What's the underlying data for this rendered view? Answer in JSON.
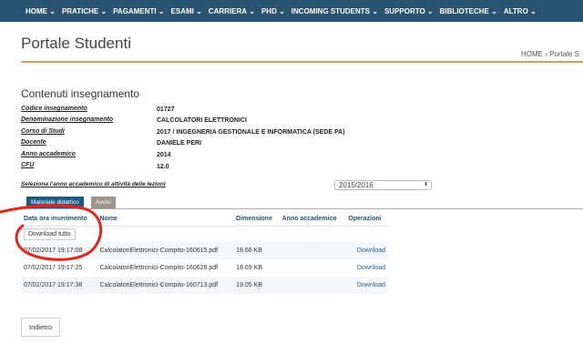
{
  "nav": [
    "HOME",
    "PRATICHE",
    "PAGAMENTI",
    "ESAMI",
    "CARRIERA",
    "PHD",
    "INCOMING STUDENTS",
    "SUPPORTO",
    "BIBLIOTECHE",
    "ALTRO"
  ],
  "page_title": "Portale Studenti",
  "breadcrumb": {
    "home": "HOME",
    "current": "Portale S"
  },
  "section_title": "Contenuti insegnamento",
  "details": [
    {
      "label": "Codice insegnamento",
      "value": "01727"
    },
    {
      "label": "Denominazione insegnamento",
      "value": "CALCOLATORI ELETTRONICI"
    },
    {
      "label": "Corso di Studi",
      "value": "2017 / INGEGNERIA GESTIONALE E INFORMATICA (SEDE PA)"
    },
    {
      "label": "Docente",
      "value": "DANIELE PERI"
    },
    {
      "label": "Anno accademico",
      "value": "2014"
    },
    {
      "label": "CFU",
      "value": "12.0"
    }
  ],
  "year_select": {
    "label": "Seleziona l'anno accademico di attività delle lezioni",
    "value": "2015/2016"
  },
  "tabs": [
    {
      "label": "Materiale didattico",
      "color": "#1f5a86"
    },
    {
      "label": "Avvisi",
      "color": "#9e948b"
    }
  ],
  "table": {
    "headers": [
      "Data ora inserimento",
      "Nome",
      "Dimensione",
      "Anno accademico",
      "Operazioni"
    ],
    "download_all": "Download tutto",
    "rows": [
      {
        "date": "07/02/2017 19:17:08",
        "name": "CalcolatoriElettronici-Compito-160615.pdf",
        "size": "18.66 KB",
        "year": "",
        "op": "Download"
      },
      {
        "date": "07/02/2017 19:17:25",
        "name": "CalcolatoriElettronici-Compito-160628.pdf",
        "size": "18.69 KB",
        "year": "",
        "op": "Download"
      },
      {
        "date": "07/02/2017 19:17:38",
        "name": "CalcolatoriElettronici-Compito-160713.pdf",
        "size": "19.05 KB",
        "year": "",
        "op": "Download"
      }
    ]
  },
  "back_label": "Indietro",
  "annotation_color": "#e8231a"
}
